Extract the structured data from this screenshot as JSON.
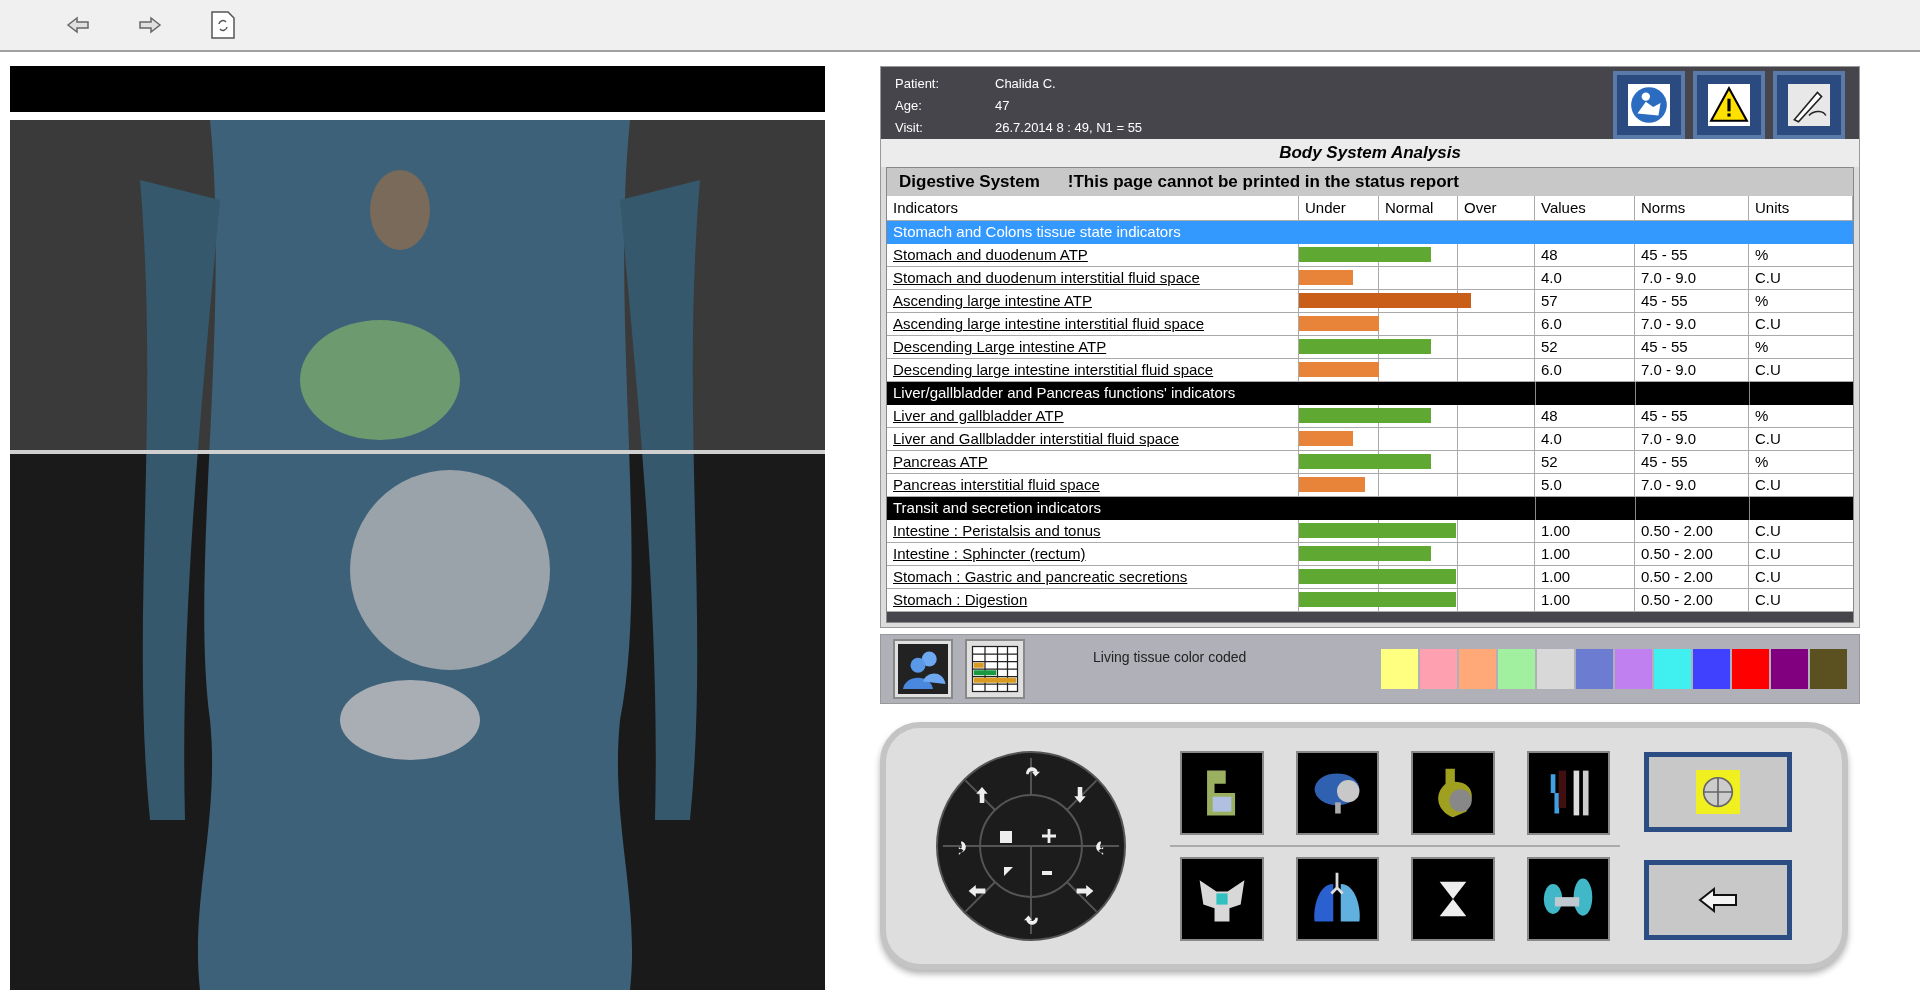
{
  "patient": [
    {
      "label": "Patient:",
      "value": "Chalida C."
    },
    {
      "label": "Age:",
      "value": "47"
    },
    {
      "label": "Visit:",
      "value": "26.7.2014  8 : 49, N1 = 55"
    }
  ],
  "title": "Body System Analysis",
  "section": {
    "name": "Digestive System",
    "notice": "!This page cannot be printed in the status report"
  },
  "columns": [
    "Indicators",
    "Under",
    "Normal",
    "Over",
    "Values",
    "Norms",
    "Units"
  ],
  "rows": [
    {
      "kind": "group",
      "label": "Stomach and Colons tissue state indicators",
      "selected": true
    },
    {
      "kind": "item",
      "label": "Stomach and duodenum ATP",
      "level": 0.56,
      "color": "#5fa832",
      "value": "48",
      "norm": "45 - 55",
      "unit": "%",
      "selected": false
    },
    {
      "kind": "item",
      "label": "Stomach and duodenum interstitial fluid space",
      "level": 0.23,
      "color": "#e8843a",
      "value": "4.0",
      "norm": "7.0 - 9.0",
      "unit": "C.U",
      "selected": false
    },
    {
      "kind": "item",
      "label": "Ascending large intestine ATP",
      "level": 0.73,
      "color": "#c85e18",
      "value": "57",
      "norm": "45 - 55",
      "unit": "%",
      "selected": false
    },
    {
      "kind": "item",
      "label": "Ascending large intestine interstitial fluid space",
      "level": 0.34,
      "color": "#e8843a",
      "value": "6.0",
      "norm": "7.0 - 9.0",
      "unit": "C.U",
      "selected": false
    },
    {
      "kind": "item",
      "label": "Descending Large intestine ATP",
      "level": 0.56,
      "color": "#5fa832",
      "value": "52",
      "norm": "45 - 55",
      "unit": "%",
      "selected": false
    },
    {
      "kind": "item",
      "label": "Descending large intestine interstitial fluid space",
      "level": 0.34,
      "color": "#e8843a",
      "value": "6.0",
      "norm": "7.0 - 9.0",
      "unit": "C.U",
      "selected": false
    },
    {
      "kind": "group",
      "label": "Liver/gallbladder and Pancreas functions' indicators",
      "selected": false
    },
    {
      "kind": "item",
      "label": "Liver and gallbladder ATP",
      "level": 0.56,
      "color": "#5fa832",
      "value": "48",
      "norm": "45 - 55",
      "unit": "%",
      "selected": false
    },
    {
      "kind": "item",
      "label": "Liver and Gallbladder interstitial fluid space",
      "level": 0.23,
      "color": "#e8843a",
      "value": "4.0",
      "norm": "7.0 - 9.0",
      "unit": "C.U",
      "selected": false
    },
    {
      "kind": "item",
      "label": "Pancreas ATP",
      "level": 0.56,
      "color": "#5fa832",
      "value": "52",
      "norm": "45 - 55",
      "unit": "%",
      "selected": false
    },
    {
      "kind": "item",
      "label": "Pancreas interstitial fluid space",
      "level": 0.28,
      "color": "#e8843a",
      "value": "5.0",
      "norm": "7.0 - 9.0",
      "unit": "C.U",
      "selected": false
    },
    {
      "kind": "group",
      "label": "Transit and secretion indicators",
      "selected": false
    },
    {
      "kind": "item",
      "label": "Intestine : Peristalsis and tonus",
      "level": 0.67,
      "color": "#5fa832",
      "value": "1.00",
      "norm": "0.50 - 2.00",
      "unit": "C.U",
      "selected": false
    },
    {
      "kind": "item",
      "label": "Intestine : Sphincter (rectum)",
      "level": 0.56,
      "color": "#5fa832",
      "value": "1.00",
      "norm": "0.50 - 2.00",
      "unit": "C.U",
      "selected": false
    },
    {
      "kind": "item",
      "label": "Stomach : Gastric and pancreatic secretions",
      "level": 0.67,
      "color": "#5fa832",
      "value": "1.00",
      "norm": "0.50 - 2.00",
      "unit": "C.U",
      "selected": false
    },
    {
      "kind": "item",
      "label": "Stomach : Digestion",
      "level": 0.67,
      "color": "#5fa832",
      "value": "1.00",
      "norm": "0.50 - 2.00",
      "unit": "C.U",
      "selected": false
    }
  ],
  "legend": {
    "label": "Living tissue color coded",
    "swatches": [
      {
        "color": "#ffff80"
      },
      {
        "color": "#ffa0b0"
      },
      {
        "color": "#ffa878"
      },
      {
        "color": "#a0f0a0"
      },
      {
        "color": "#d8d8d8"
      },
      {
        "color": "#6c7cd0"
      },
      {
        "color": "#c080f0"
      },
      {
        "color": "#40f0f0"
      },
      {
        "color": "#4040ff"
      },
      {
        "color": "#ff0000"
      },
      {
        "color": "#800080"
      },
      {
        "color": "#5a5020"
      }
    ]
  }
}
